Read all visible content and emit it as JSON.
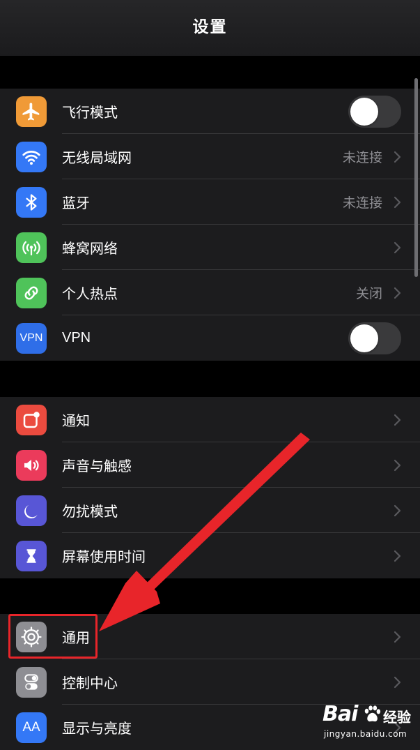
{
  "nav": {
    "title": "设置"
  },
  "groups": [
    {
      "items": [
        {
          "label": "飞行模式",
          "icon": "airplane-icon",
          "icon_bg": "#f09a37",
          "control": "toggle",
          "toggle_on": false
        },
        {
          "label": "无线局域网",
          "icon": "wifi-icon",
          "icon_bg": "#3478f6",
          "value": "未连接",
          "control": "chevron"
        },
        {
          "label": "蓝牙",
          "icon": "bluetooth-icon",
          "icon_bg": "#3478f6",
          "value": "未连接",
          "control": "chevron"
        },
        {
          "label": "蜂窝网络",
          "icon": "cellular-antenna-icon",
          "icon_bg": "#4fc35a",
          "control": "chevron"
        },
        {
          "label": "个人热点",
          "icon": "hotspot-chain-icon",
          "icon_bg": "#4fc35a",
          "value": "关闭",
          "control": "chevron"
        },
        {
          "label": "VPN",
          "icon": "vpn-icon",
          "icon_text": "VPN",
          "icon_bg": "#2f6ee8",
          "control": "toggle",
          "toggle_on": false
        }
      ]
    },
    {
      "items": [
        {
          "label": "通知",
          "icon": "notifications-icon",
          "icon_bg": "#eb4b3f",
          "control": "chevron"
        },
        {
          "label": "声音与触感",
          "icon": "speaker-icon",
          "icon_bg": "#eb3b5b",
          "control": "chevron"
        },
        {
          "label": "勿扰模式",
          "icon": "moon-icon",
          "icon_bg": "#5856d6",
          "control": "chevron"
        },
        {
          "label": "屏幕使用时间",
          "icon": "hourglass-icon",
          "icon_bg": "#5856d6",
          "control": "chevron"
        }
      ]
    },
    {
      "items": [
        {
          "label": "通用",
          "icon": "gear-icon",
          "icon_bg": "#8e8e93",
          "control": "chevron"
        },
        {
          "label": "控制中心",
          "icon": "toggles-icon",
          "icon_bg": "#8e8e93",
          "control": "chevron"
        },
        {
          "label": "显示与亮度",
          "icon": "text-size-icon",
          "icon_text": "AA",
          "icon_bg": "#3478f6",
          "control": "chevron"
        }
      ]
    }
  ],
  "annotation": {
    "color": "#e8252a",
    "highlighted_item": "通用"
  },
  "watermark": {
    "brand": "Bai",
    "suffix": "经验",
    "domain": "jingyan.baidu.com"
  }
}
